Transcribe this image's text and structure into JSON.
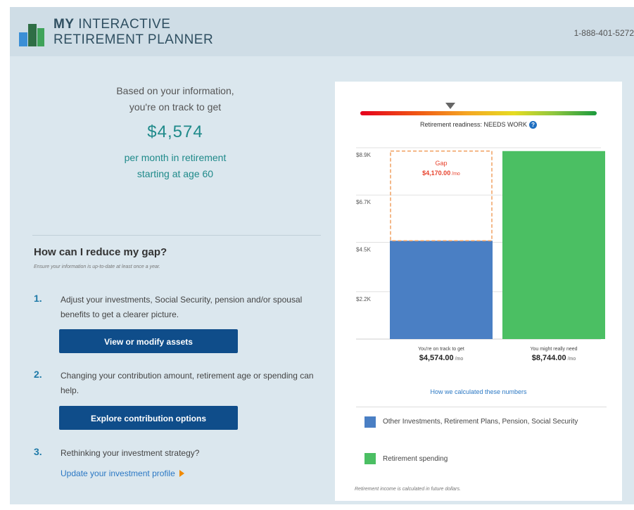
{
  "header": {
    "brand_bold": "MY",
    "brand_line1": "INTERACTIVE",
    "brand_line2": "RETIREMENT PLANNER",
    "phone": "1-888-401-5272"
  },
  "summary": {
    "line1": "Based on your information,",
    "line2": "you're on track to get",
    "amount": "$4,574",
    "line3": "per month in retirement",
    "line4": "starting at age 60"
  },
  "reduce_gap": {
    "title": "How can I reduce my gap?",
    "subtitle": "Ensure your information is up-to-date at least once a year.",
    "steps": [
      {
        "num": "1.",
        "text": "Adjust your investments, Social Security, pension and/or spousal benefits to get a clearer picture.",
        "button": "View or modify assets"
      },
      {
        "num": "2.",
        "text": "Changing your contribution amount, retirement age or spending can help.",
        "button": "Explore contribution options"
      },
      {
        "num": "3.",
        "text": "Rethinking your investment strategy?",
        "link": "Update your investment profile"
      }
    ]
  },
  "readiness": {
    "label": "Retirement readiness: NEEDS WORK",
    "help_icon": "question-icon",
    "marker_fraction": 0.38
  },
  "chart_data": {
    "type": "bar",
    "yticks": [
      "$8.9K",
      "$6.7K",
      "$4.5K",
      "$2.2K"
    ],
    "ytick_values": [
      8900,
      6700,
      4500,
      2200
    ],
    "ylim": [
      0,
      8900
    ],
    "categories": [
      "You're on track to get",
      "You might really need"
    ],
    "values": [
      4574,
      8744
    ],
    "value_labels": [
      "$4,574.00",
      "$8,744.00"
    ],
    "units": [
      "/mo",
      "/mo"
    ],
    "colors": [
      "#4a7fc4",
      "#4bbf63"
    ],
    "gap": {
      "label": "Gap",
      "value_label": "$4,170.00",
      "unit": "/mo",
      "value": 4170,
      "color": "#e8432e"
    }
  },
  "calc_link": "How we calculated these numbers",
  "legend": [
    {
      "label": "Other Investments, Retirement Plans, Pension, Social Security",
      "color": "#4a7fc4"
    },
    {
      "label": "Retirement spending",
      "color": "#4bbf63"
    }
  ],
  "footnote": "Retirement income is calculated in future dollars."
}
